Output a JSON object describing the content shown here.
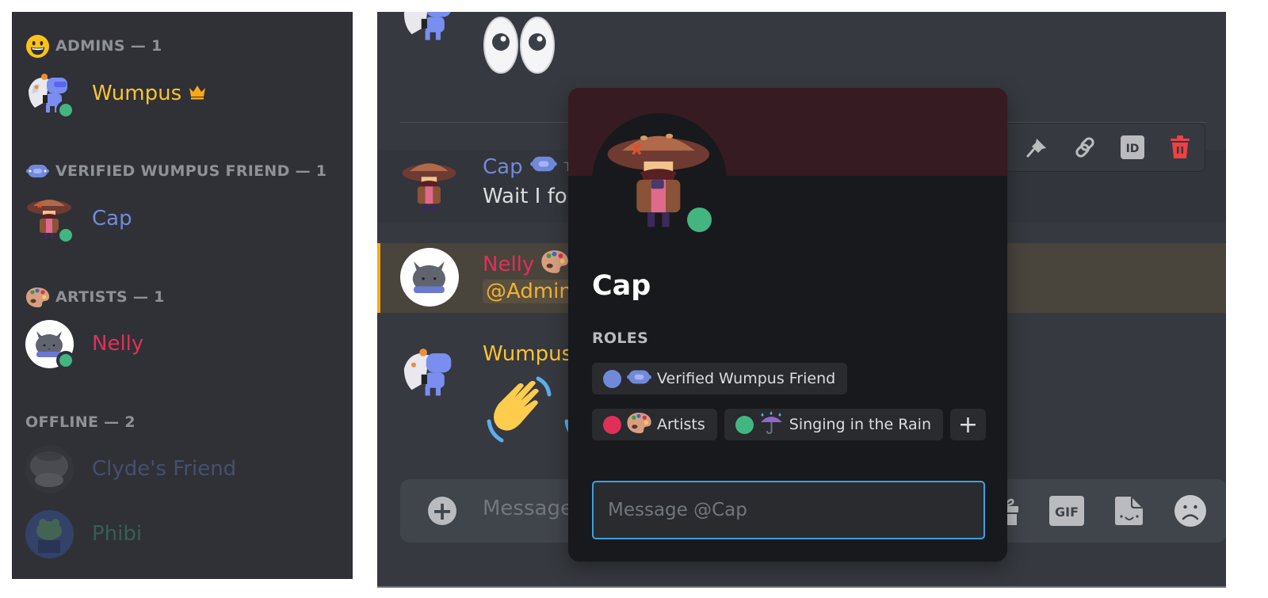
{
  "member_list": {
    "groups": [
      {
        "header": "ADMINS — 1",
        "icon": "grinning-face-emoji",
        "members": [
          {
            "name": "Wumpus",
            "color": "#fcc331",
            "status": "online",
            "badge": "crown-icon",
            "avatar": "wumpus-avatar"
          }
        ]
      },
      {
        "header": "VERIFIED WUMPUS FRIEND — 1",
        "icon": "wumpus-face-icon",
        "members": [
          {
            "name": "Cap",
            "color": "#7289da",
            "status": "online",
            "avatar": "cap-avatar"
          }
        ]
      },
      {
        "header": "ARTISTS — 1",
        "icon": "artist-palette-emoji",
        "members": [
          {
            "name": "Nelly",
            "color": "#e0305a",
            "status": "online",
            "avatar": "nelly-avatar"
          }
        ]
      },
      {
        "header": "OFFLINE — 2",
        "members": [
          {
            "name": "Clyde's Friend",
            "color": "#7289da",
            "status": "offline",
            "avatar": "clydes-friend-avatar"
          },
          {
            "name": "Phibi",
            "color": "#43b581",
            "status": "offline",
            "avatar": "phibi-avatar"
          }
        ]
      }
    ]
  },
  "chat": {
    "messages": [
      {
        "author": "",
        "content_emoji": "👀",
        "avatar": "wumpus-avatar"
      },
      {
        "author": "Cap",
        "author_color": "#7289da",
        "author_badge": "wumpus-face-icon",
        "timestamp": "T",
        "content": "Wait I fo",
        "state": "hover"
      },
      {
        "author": "Nelly",
        "author_color": "#e0305a",
        "author_badge": "artist-palette-emoji",
        "content_mention": "@Admin",
        "state": "mentioned"
      },
      {
        "author": "Wumpus",
        "author_color": "#fcc331",
        "content_emoji": "👋👋"
      }
    ],
    "message_toolbar": {
      "buttons": [
        "pin-icon",
        "copy-link-icon",
        "copy-id-icon",
        "delete-icon"
      ],
      "id_label": "ID",
      "delete_color": "#ed4245"
    },
    "composer": {
      "placeholder": "Message",
      "add_button": "+",
      "icons": [
        "gift-icon",
        "gif-icon",
        "sticker-icon",
        "emoji-icon"
      ],
      "gif_label": "GIF"
    }
  },
  "profile_popout": {
    "username": "Cap",
    "status": "online",
    "banner_color": "#361b22",
    "roles_label": "ROLES",
    "roles": [
      {
        "name": "Verified Wumpus Friend",
        "color": "#7289da",
        "icon": "wumpus-face-icon"
      },
      {
        "name": "Artists",
        "color": "#e0305a",
        "icon": "artist-palette-emoji"
      },
      {
        "name": "Singing in the Rain",
        "color": "#43b581",
        "icon": "umbrella-rain-emoji"
      }
    ],
    "add_role_label": "+",
    "message_placeholder": "Message @Cap",
    "message_value": ""
  }
}
